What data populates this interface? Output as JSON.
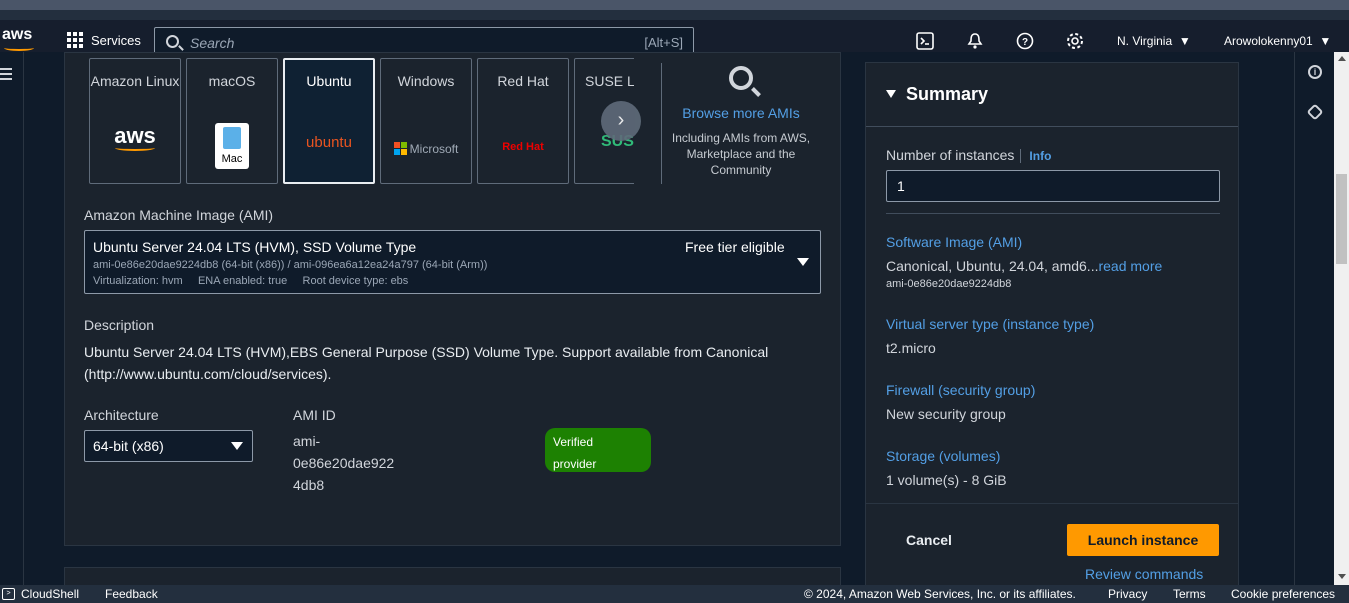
{
  "header": {
    "logo": "aws",
    "services": "Services",
    "search_placeholder": "Search",
    "search_shortcut": "[Alt+S]",
    "region": "N. Virginia",
    "user": "Arowolokenny01"
  },
  "ami_tiles": [
    {
      "label": "Amazon Linux",
      "logo_text": "aws"
    },
    {
      "label": "macOS",
      "logo_text": "Mac"
    },
    {
      "label": "Ubuntu",
      "logo_text": "ubuntu"
    },
    {
      "label": "Windows",
      "logo_text": "Microsoft"
    },
    {
      "label": "Red Hat",
      "logo_text": "Red Hat"
    },
    {
      "label": "SUSE Li",
      "logo_text": "SUS"
    }
  ],
  "browse": {
    "link": "Browse more AMIs",
    "sub": "Including AMIs from AWS, Marketplace and the Community"
  },
  "ami": {
    "label": "Amazon Machine Image (AMI)",
    "title": "Ubuntu Server 24.04 LTS (HVM), SSD Volume Type",
    "ids": "ami-0e86e20dae9224db8 (64-bit (x86)) / ami-096ea6a12ea24a797 (64-bit (Arm))",
    "meta": "Virtualization: hvm     ENA enabled: true     Root device type: ebs",
    "free_tier": "Free tier eligible"
  },
  "description": {
    "label": "Description",
    "text": "Ubuntu Server 24.04 LTS (HVM),EBS General Purpose (SSD) Volume Type. Support available from Canonical (http://www.ubuntu.com/cloud/services)."
  },
  "architecture": {
    "label": "Architecture",
    "value": "64-bit (x86)"
  },
  "ami_id": {
    "label": "AMI ID",
    "line1": "ami-",
    "line2": "0e86e20dae922",
    "line3": "4db8"
  },
  "badge": {
    "line1": "Verified",
    "line2": "provider"
  },
  "summary": {
    "title": "Summary",
    "instances_label": "Number of instances",
    "info": "Info",
    "instances_value": "1",
    "software_label": "Software Image (AMI)",
    "software_value": "Canonical, Ubuntu, 24.04, amd6...",
    "read_more": "read more",
    "software_id": "ami-0e86e20dae9224db8",
    "type_label": "Virtual server type (instance type)",
    "type_value": "t2.micro",
    "firewall_label": "Firewall (security group)",
    "firewall_value": "New security group",
    "storage_label": "Storage (volumes)",
    "storage_value": "1 volume(s) - 8 GiB",
    "cancel": "Cancel",
    "launch": "Launch instance",
    "review": "Review commands"
  },
  "footer": {
    "cloudshell": "CloudShell",
    "feedback": "Feedback",
    "copyright": "© 2024, Amazon Web Services, Inc. or its affiliates.",
    "privacy": "Privacy",
    "terms": "Terms",
    "cookies": "Cookie preferences"
  },
  "colors": {
    "accent": "#ff9900",
    "link": "#539fe5",
    "badge": "#1d8102"
  }
}
